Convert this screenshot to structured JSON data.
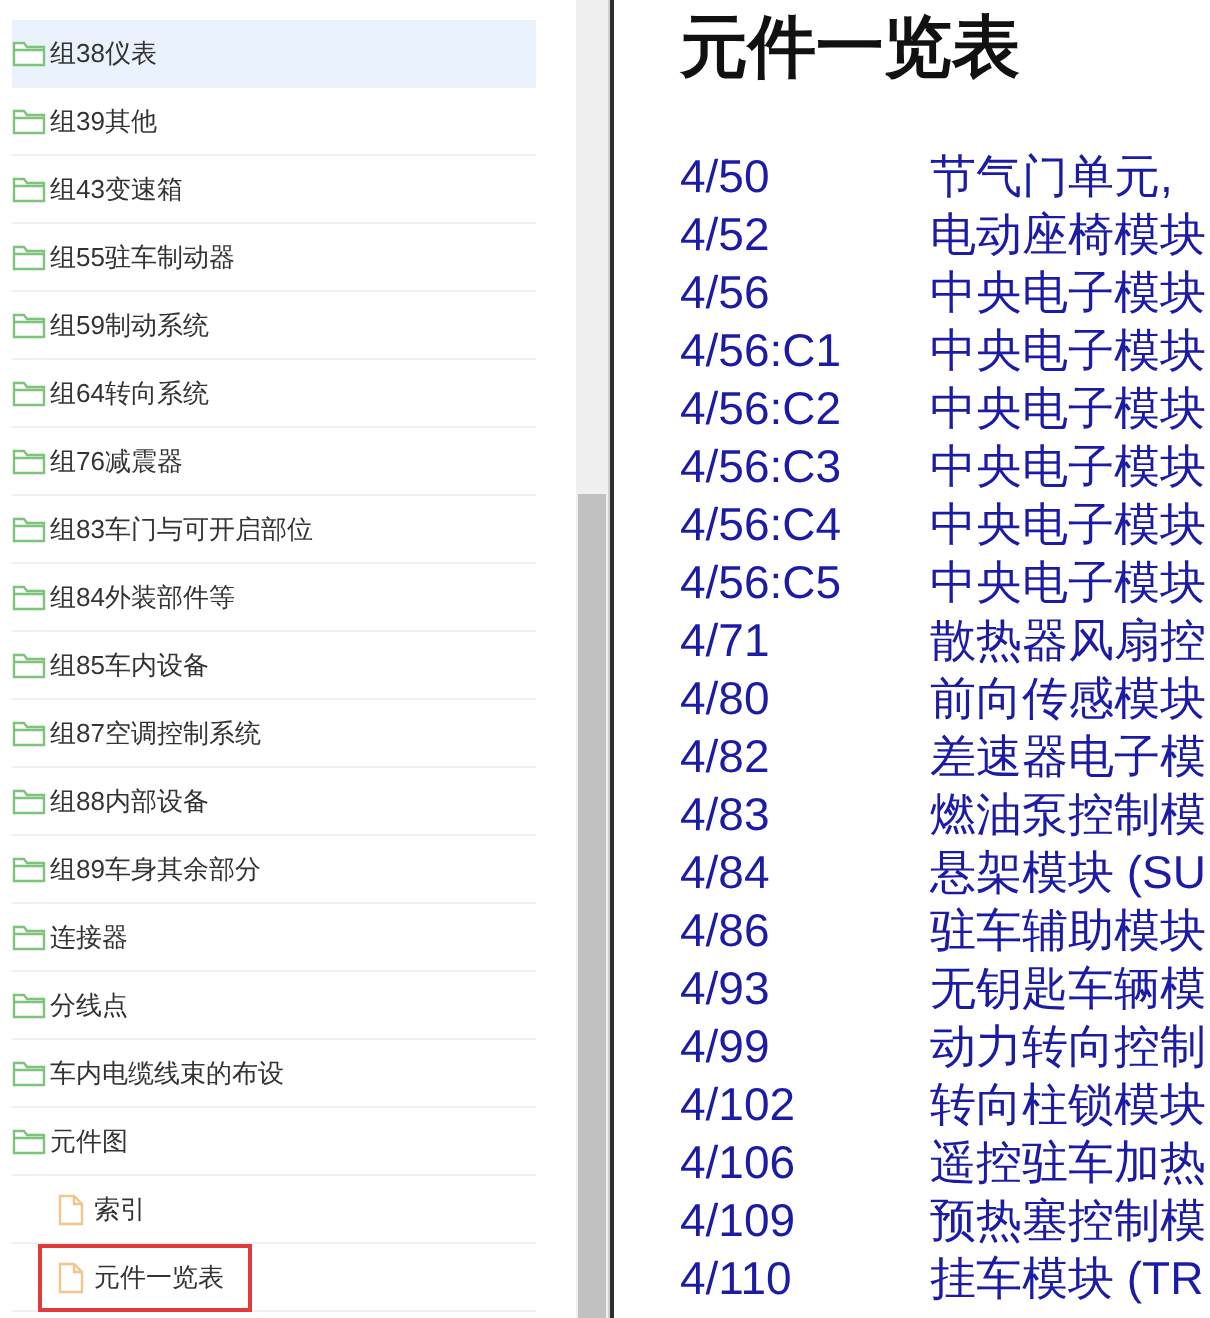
{
  "sidebar": {
    "items": [
      {
        "label": "组38仪表",
        "kind": "folder",
        "selected": true,
        "highlighted": false
      },
      {
        "label": "组39其他",
        "kind": "folder",
        "selected": false,
        "highlighted": false
      },
      {
        "label": "组43变速箱",
        "kind": "folder",
        "selected": false,
        "highlighted": false
      },
      {
        "label": "组55驻车制动器",
        "kind": "folder",
        "selected": false,
        "highlighted": false
      },
      {
        "label": "组59制动系统",
        "kind": "folder",
        "selected": false,
        "highlighted": false
      },
      {
        "label": "组64转向系统",
        "kind": "folder",
        "selected": false,
        "highlighted": false
      },
      {
        "label": "组76减震器",
        "kind": "folder",
        "selected": false,
        "highlighted": false
      },
      {
        "label": "组83车门与可开启部位",
        "kind": "folder",
        "selected": false,
        "highlighted": false
      },
      {
        "label": "组84外装部件等",
        "kind": "folder",
        "selected": false,
        "highlighted": false
      },
      {
        "label": "组85车内设备",
        "kind": "folder",
        "selected": false,
        "highlighted": false
      },
      {
        "label": "组87空调控制系统",
        "kind": "folder",
        "selected": false,
        "highlighted": false
      },
      {
        "label": "组88内部设备",
        "kind": "folder",
        "selected": false,
        "highlighted": false
      },
      {
        "label": "组89车身其余部分",
        "kind": "folder",
        "selected": false,
        "highlighted": false
      },
      {
        "label": "连接器",
        "kind": "folder",
        "selected": false,
        "highlighted": false
      },
      {
        "label": "分线点",
        "kind": "folder",
        "selected": false,
        "highlighted": false
      },
      {
        "label": "车内电缆线束的布设",
        "kind": "folder",
        "selected": false,
        "highlighted": false
      },
      {
        "label": "元件图",
        "kind": "folder",
        "selected": false,
        "highlighted": false,
        "children": [
          {
            "label": "索引",
            "kind": "file",
            "selected": false,
            "highlighted": false
          },
          {
            "label": "元件一览表",
            "kind": "file",
            "selected": false,
            "highlighted": true
          }
        ]
      }
    ]
  },
  "content": {
    "title": "元件一览表",
    "rows": [
      {
        "code": "4/50",
        "name": "节气门单元,"
      },
      {
        "code": "4/52",
        "name": "电动座椅模块"
      },
      {
        "code": "4/56",
        "name": "中央电子模块"
      },
      {
        "code": "4/56:C1",
        "name": "中央电子模块"
      },
      {
        "code": "4/56:C2",
        "name": "中央电子模块"
      },
      {
        "code": "4/56:C3",
        "name": "中央电子模块"
      },
      {
        "code": "4/56:C4",
        "name": "中央电子模块"
      },
      {
        "code": "4/56:C5",
        "name": "中央电子模块"
      },
      {
        "code": "4/71",
        "name": "散热器风扇控"
      },
      {
        "code": "4/80",
        "name": "前向传感模块"
      },
      {
        "code": "4/82",
        "name": "差速器电子模"
      },
      {
        "code": "4/83",
        "name": "燃油泵控制模"
      },
      {
        "code": "4/84",
        "name": "悬架模块 (SU"
      },
      {
        "code": "4/86",
        "name": "驻车辅助模块"
      },
      {
        "code": "4/93",
        "name": "无钥匙车辆模"
      },
      {
        "code": "4/99",
        "name": "动力转向控制"
      },
      {
        "code": "4/102",
        "name": "转向柱锁模块"
      },
      {
        "code": "4/106",
        "name": "遥控驻车加热"
      },
      {
        "code": "4/109",
        "name": "预热塞控制模"
      },
      {
        "code": "4/110",
        "name": "挂车模块 (TR"
      }
    ]
  }
}
